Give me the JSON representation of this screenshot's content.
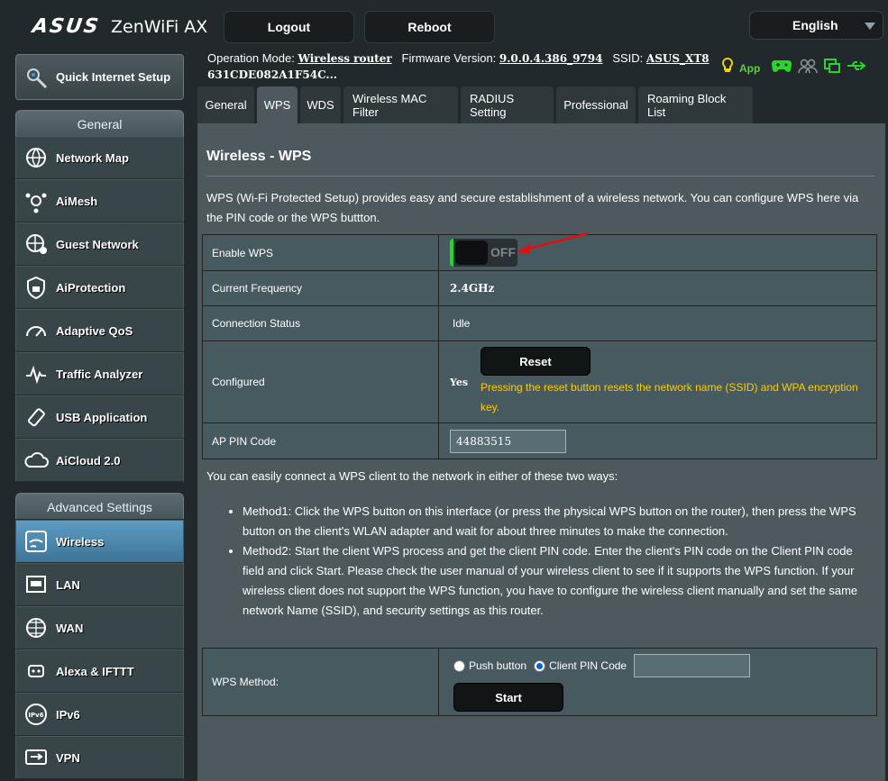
{
  "header": {
    "brand": "ASUS",
    "model": "ZenWiFi AX",
    "logout_label": "Logout",
    "reboot_label": "Reboot",
    "language": "English"
  },
  "info": {
    "operation_mode_label": "Operation Mode:",
    "operation_mode_value": "Wireless router",
    "firmware_label": "Firmware Version:",
    "firmware_value": "9.0.0.4.386_9794",
    "ssid_label": "SSID:",
    "ssid_value": "ASUS_XT8",
    "ssid_extra": "631CDE082A1F54C...",
    "app_label": "App"
  },
  "sidebar": {
    "quick_setup": "Quick Internet Setup",
    "general_title": "General",
    "general_items": [
      "Network Map",
      "AiMesh",
      "Guest Network",
      "AiProtection",
      "Adaptive QoS",
      "Traffic Analyzer",
      "USB Application",
      "AiCloud 2.0"
    ],
    "advanced_title": "Advanced Settings",
    "advanced_items": [
      "Wireless",
      "LAN",
      "WAN",
      "Alexa & IFTTT",
      "IPv6",
      "VPN"
    ]
  },
  "tabs": [
    "General",
    "WPS",
    "WDS",
    "Wireless MAC Filter",
    "RADIUS Setting",
    "Professional",
    "Roaming Block List"
  ],
  "page": {
    "title": "Wireless - WPS",
    "description": "WPS (Wi-Fi Protected Setup) provides easy and secure establishment of a wireless network. You can configure WPS here via the PIN code or the WPS buttton.",
    "rows": {
      "enable_wps_label": "Enable WPS",
      "enable_wps_state": "OFF",
      "frequency_label": "Current Frequency",
      "frequency_value": "2.4GHz",
      "status_label": "Connection Status",
      "status_value": "Idle",
      "configured_label": "Configured",
      "configured_value": "Yes",
      "reset_label": "Reset",
      "reset_note": "Pressing the reset button resets the network name (SSID) and WPA encryption key.",
      "pin_label": "AP PIN Code",
      "pin_value": "44883515"
    },
    "ways_intro": "You can easily connect a WPS client to the network in either of these two ways:",
    "method1": "Method1: Click the WPS button on this interface (or press the physical WPS button on the router), then press the WPS button on the client's WLAN adapter and wait for about three minutes to make the connection.",
    "method2": "Method2: Start the client WPS process and get the client PIN code. Enter the client's PIN code on the Client PIN code field and click Start. Please check the user manual of your wireless client to see if it supports the WPS function. If your wireless client does not support the WPS function, you have to configure the wireless client manually and set the same network Name (SSID), and security settings as this router.",
    "wps_method_label": "WPS Method:",
    "push_button_label": "Push button",
    "client_pin_label": "Client PIN Code",
    "start_label": "Start"
  },
  "colors": {
    "accent_green": "#2bd42b",
    "amber": "#ffcc00",
    "active_blue": "#4f8cb3",
    "arrow_red": "#e01010"
  }
}
